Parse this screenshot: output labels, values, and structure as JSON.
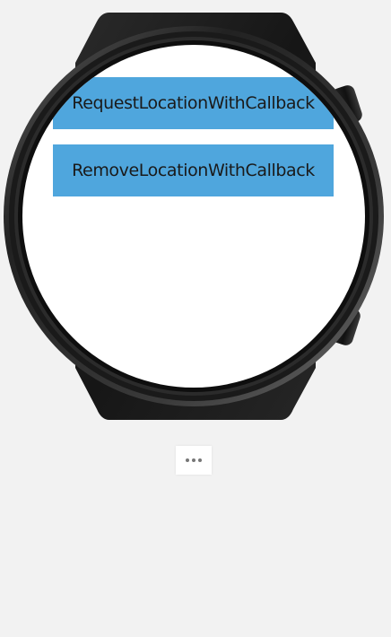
{
  "screen": {
    "buttons": [
      {
        "label": "RequestLocationWithCallback"
      },
      {
        "label": "RemoveLocationWithCallback"
      }
    ]
  },
  "toolbar": {
    "more_icon": "more-horizontal-icon"
  },
  "colors": {
    "button_bg": "#4fa6dd",
    "button_text": "#1a1a1a",
    "background": "#f2f2f2",
    "watch_body": "#1c1c1c"
  }
}
